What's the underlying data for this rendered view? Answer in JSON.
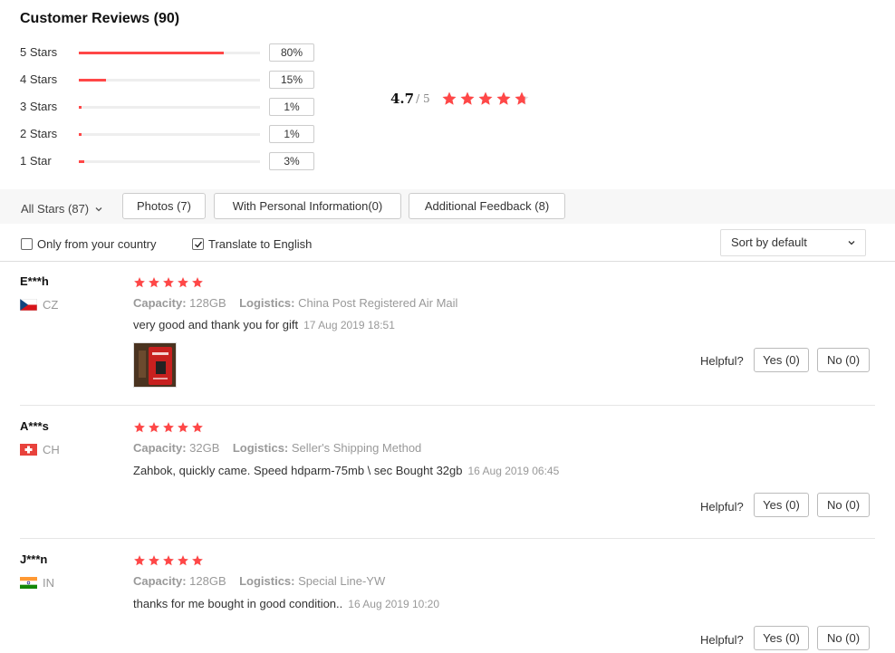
{
  "header": {
    "title": "Customer Reviews (90)"
  },
  "distribution": [
    {
      "label": "5 Stars",
      "pct": "80%",
      "fraction": 0.8
    },
    {
      "label": "4 Stars",
      "pct": "15%",
      "fraction": 0.15
    },
    {
      "label": "3 Stars",
      "pct": "1%",
      "fraction": 0.01
    },
    {
      "label": "2 Stars",
      "pct": "1%",
      "fraction": 0.01
    },
    {
      "label": "1 Star",
      "pct": "3%",
      "fraction": 0.03
    }
  ],
  "average": {
    "value": "4.7",
    "out_of": "/ 5",
    "stars": 4.7
  },
  "filters": {
    "all_stars": "All Stars (87)",
    "photos": "Photos (7)",
    "personal": "With Personal Information(0)",
    "additional": "Additional Feedback (8)"
  },
  "options": {
    "only_country": "Only from your country",
    "only_country_checked": false,
    "translate": "Translate to English",
    "translate_checked": true,
    "sort": "Sort by default"
  },
  "reviews": [
    {
      "name": "E***h",
      "country": "CZ",
      "flag": "cz-flag-icon",
      "stars": 5,
      "capacity_label": "Capacity:",
      "capacity": "128GB",
      "logistics_label": "Logistics:",
      "logistics": "China Post Registered Air Mail",
      "text": "very good and thank you for gift",
      "date": "17 Aug 2019 18:51",
      "helpful": "Helpful?",
      "yes": "Yes (0)",
      "no": "No (0)"
    },
    {
      "name": "A***s",
      "country": "CH",
      "flag": "ch-flag-icon",
      "stars": 5,
      "capacity_label": "Capacity:",
      "capacity": "32GB",
      "logistics_label": "Logistics:",
      "logistics": "Seller's Shipping Method",
      "text": "Zahbok, quickly came. Speed hdparm-75mb \\ sec Bought 32gb",
      "date": "16 Aug 2019 06:45",
      "helpful": "Helpful?",
      "yes": "Yes (0)",
      "no": "No (0)"
    },
    {
      "name": "J***n",
      "country": "IN",
      "flag": "in-flag-icon",
      "stars": 5,
      "capacity_label": "Capacity:",
      "capacity": "128GB",
      "logistics_label": "Logistics:",
      "logistics": "Special Line-YW",
      "text": "thanks for me bought in good condition..",
      "date": "16 Aug 2019 10:20",
      "helpful": "Helpful?",
      "yes": "Yes (0)",
      "no": "No (0)"
    }
  ],
  "colors": {
    "accent": "#ff4747",
    "track": "#eeeeee"
  }
}
